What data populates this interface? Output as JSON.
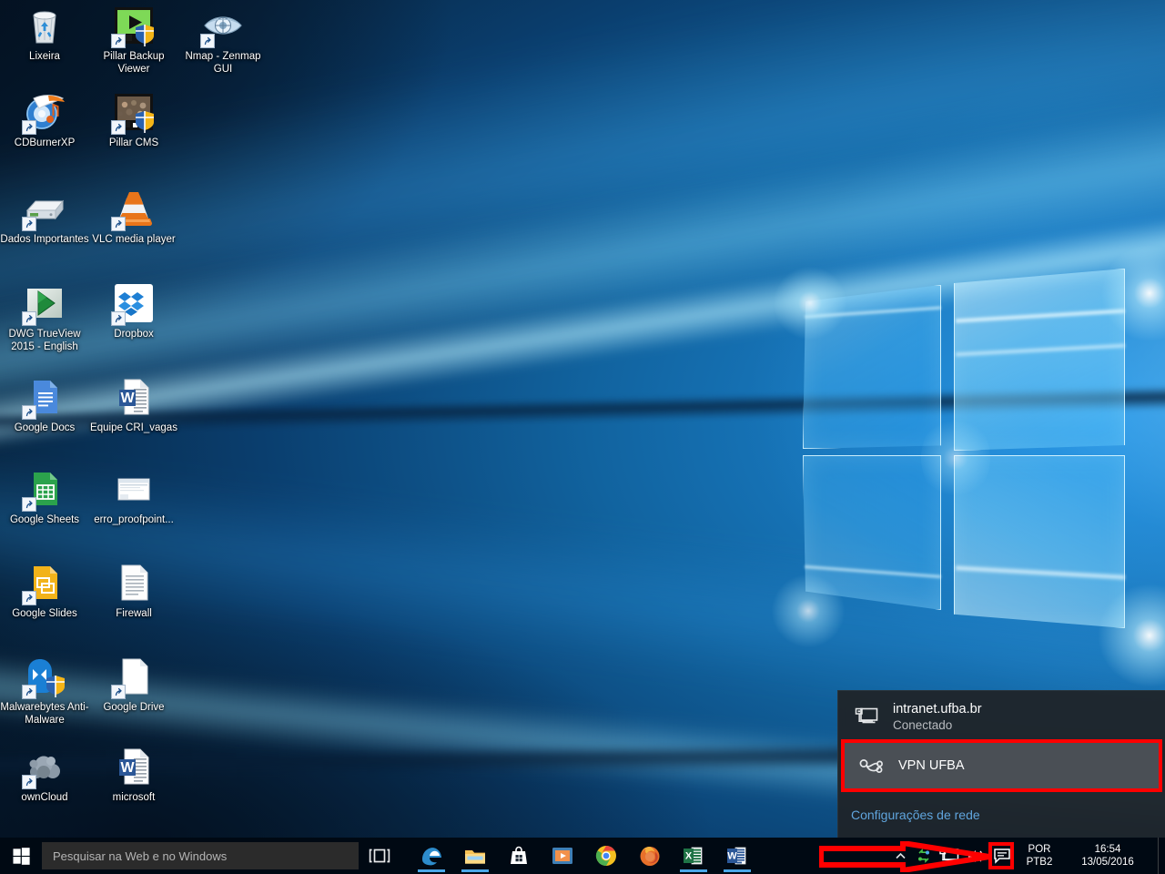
{
  "desktop": {
    "icons": [
      {
        "name": "lixeira",
        "label": "Lixeira",
        "art": "recycle-bin-icon",
        "shortcut": false,
        "col": 0,
        "row": 0
      },
      {
        "name": "pillar-backup-viewer",
        "label": "Pillar Backup Viewer",
        "art": "pillar-backup-viewer-icon",
        "shortcut": true,
        "col": 1,
        "row": 0
      },
      {
        "name": "nmap-zenmap-gui",
        "label": "Nmap - Zenmap GUI",
        "art": "nmap-zenmap-icon",
        "shortcut": true,
        "col": 2,
        "row": 0
      },
      {
        "name": "cdburnerxp",
        "label": "CDBurnerXP",
        "art": "cdburnerxp-icon",
        "shortcut": true,
        "col": 0,
        "row": 1
      },
      {
        "name": "pillar-cms",
        "label": "Pillar CMS",
        "art": "pillar-cms-icon",
        "shortcut": true,
        "col": 1,
        "row": 1
      },
      {
        "name": "dados-importantes",
        "label": "Dados Importantes",
        "art": "hard-drive-icon",
        "shortcut": true,
        "col": 0,
        "row": 2
      },
      {
        "name": "vlc-media-player",
        "label": "VLC media player",
        "art": "vlc-cone-icon",
        "shortcut": true,
        "col": 1,
        "row": 2
      },
      {
        "name": "dwg-trueview",
        "label": "DWG TrueView 2015 - English",
        "art": "dwg-trueview-icon",
        "shortcut": true,
        "col": 0,
        "row": 3
      },
      {
        "name": "dropbox",
        "label": "Dropbox",
        "art": "dropbox-icon",
        "shortcut": true,
        "col": 1,
        "row": 3
      },
      {
        "name": "google-docs",
        "label": "Google Docs",
        "art": "google-docs-icon",
        "shortcut": true,
        "col": 0,
        "row": 4
      },
      {
        "name": "equipe-cri-vagas",
        "label": "Equipe CRI_vagas",
        "art": "word-doc-icon",
        "shortcut": false,
        "col": 1,
        "row": 4
      },
      {
        "name": "google-sheets",
        "label": "Google Sheets",
        "art": "google-sheets-icon",
        "shortcut": true,
        "col": 0,
        "row": 5
      },
      {
        "name": "erro-proofpoint",
        "label": "erro_proofpoint...",
        "art": "image-file-icon",
        "shortcut": false,
        "col": 1,
        "row": 5
      },
      {
        "name": "google-slides",
        "label": "Google Slides",
        "art": "google-slides-icon",
        "shortcut": true,
        "col": 0,
        "row": 6
      },
      {
        "name": "firewall",
        "label": "Firewall",
        "art": "text-file-icon",
        "shortcut": false,
        "col": 1,
        "row": 6
      },
      {
        "name": "malwarebytes",
        "label": "Malwarebytes Anti-Malware",
        "art": "malwarebytes-icon",
        "shortcut": true,
        "col": 0,
        "row": 7
      },
      {
        "name": "google-drive",
        "label": "Google Drive",
        "art": "blank-file-icon",
        "shortcut": true,
        "col": 1,
        "row": 7
      },
      {
        "name": "owncloud",
        "label": "ownCloud",
        "art": "owncloud-icon",
        "shortcut": true,
        "col": 0,
        "row": 8
      },
      {
        "name": "microsoft",
        "label": "microsoft",
        "art": "word-doc-icon",
        "shortcut": false,
        "col": 1,
        "row": 8
      }
    ]
  },
  "network_flyout": {
    "ethernet": {
      "icon": "ethernet-icon",
      "name": "intranet.ufba.br",
      "status": "Conectado"
    },
    "vpn": {
      "icon": "vpn-icon",
      "name": "VPN UFBA"
    },
    "settings_link": "Configurações de rede",
    "highlight_color": "#ff0000",
    "selected_bg": "#4a4f55"
  },
  "taskbar": {
    "start_label": "Iniciar",
    "start_icon": "windows-logo-icon",
    "search": {
      "placeholder": "Pesquisar na Web e no Windows",
      "value": "",
      "icon": "search-box"
    },
    "task_view_label": "Visão de Tarefas",
    "task_view_icon": "task-view-icon",
    "apps": [
      {
        "name": "microsoft-edge",
        "label": "Microsoft Edge",
        "icon": "edge-icon",
        "running": true
      },
      {
        "name": "file-explorer",
        "label": "Explorador de Arquivos",
        "icon": "file-explorer-icon",
        "running": true
      },
      {
        "name": "microsoft-store",
        "label": "Loja",
        "icon": "store-icon",
        "running": false
      },
      {
        "name": "movies-tv",
        "label": "Filmes e TV",
        "icon": "movies-tv-icon",
        "running": false
      },
      {
        "name": "google-chrome",
        "label": "Google Chrome",
        "icon": "chrome-icon",
        "running": false
      },
      {
        "name": "mozilla-firefox",
        "label": "Mozilla Firefox",
        "icon": "firefox-icon",
        "running": false
      },
      {
        "name": "microsoft-excel",
        "label": "Microsoft Excel",
        "icon": "excel-icon",
        "running": true
      },
      {
        "name": "microsoft-word",
        "label": "Microsoft Word",
        "icon": "word-icon",
        "running": true
      }
    ],
    "tray": {
      "hidden_icons_label": "Mostrar ícones ocultos",
      "network_icon": "ethernet-tray-icon",
      "volume_icon": "speaker-icon",
      "action_center_icon": "action-center-icon",
      "language_line1": "POR",
      "language_line2": "PTB2",
      "time": "16:54",
      "date": "13/05/2016"
    }
  },
  "annotation": {
    "arrow_color": "#ff0000",
    "arrow_name": "red-arrow-annotation",
    "box_name": "red-highlight-box"
  }
}
